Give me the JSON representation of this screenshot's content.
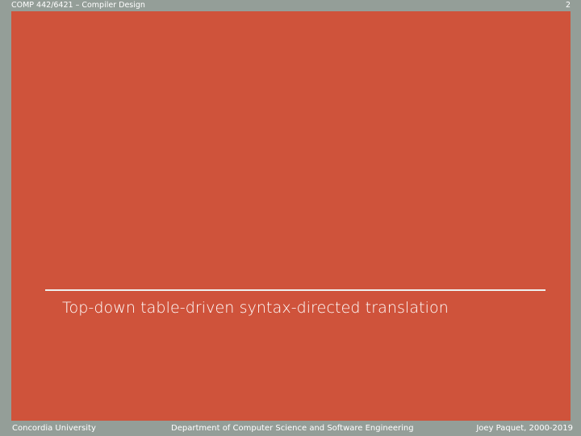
{
  "header": {
    "course": "COMP 442/6421 – Compiler Design",
    "page_number": "2"
  },
  "slide": {
    "title": "Top-down table-driven syntax-directed translation"
  },
  "footer": {
    "left": "Concordia University",
    "center": "Department of Computer Science and Software Engineering",
    "right": "Joey Paquet, 2000-2019"
  },
  "colors": {
    "panel": "#cf533b",
    "background": "#949e98",
    "text": "#ffffff"
  }
}
